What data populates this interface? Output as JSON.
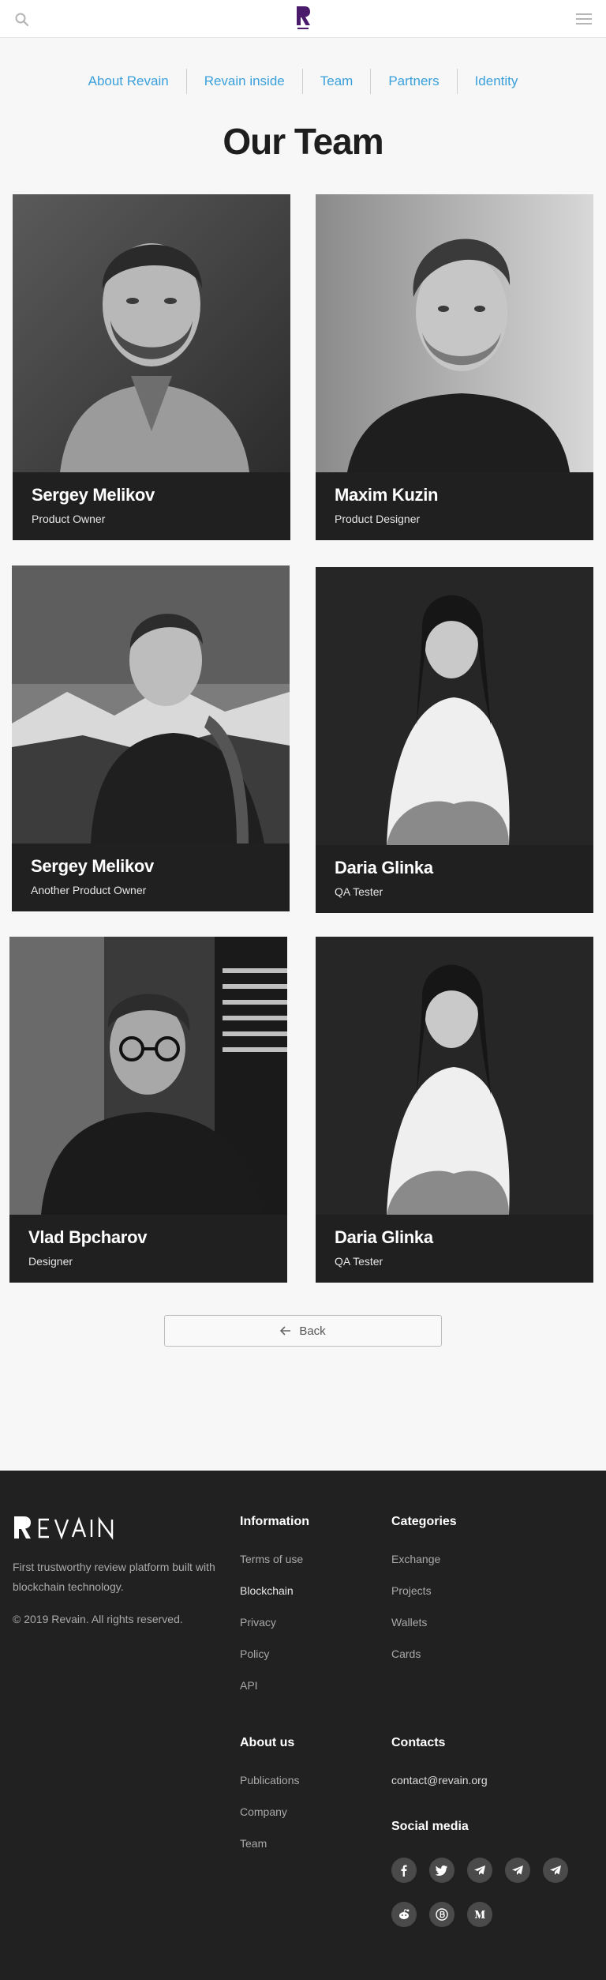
{
  "nav": [
    "About Revain",
    "Revain inside",
    "Team",
    "Partners",
    "Identity"
  ],
  "page": {
    "title": "Our Team"
  },
  "team": [
    {
      "name": "Sergey Melikov",
      "role": "Product Owner"
    },
    {
      "name": "Maxim Kuzin",
      "role": "Product Designer"
    },
    {
      "name": "Sergey Melikov",
      "role": "Another Product Owner"
    },
    {
      "name": "Daria Glinka",
      "role": "QA Tester"
    },
    {
      "name": "Vlad Bpcharov",
      "role": "Designer"
    },
    {
      "name": "Daria Glinka",
      "role": "QA Tester"
    }
  ],
  "back_label": "Back",
  "footer": {
    "tagline": "First trustworthy review platform built with blockchain technology.",
    "copyright": "© 2019 Revain. All rights reserved.",
    "information": {
      "title": "Information",
      "links": [
        "Terms of use",
        "Blockchain",
        "Privacy",
        "Policy",
        "API"
      ]
    },
    "categories": {
      "title": "Categories",
      "links": [
        "Exchange",
        "Projects",
        "Wallets",
        "Cards"
      ]
    },
    "about": {
      "title": "About us",
      "links": [
        "Publications",
        "Company",
        "Team"
      ]
    },
    "contacts": {
      "title": "Contacts",
      "email": "contact@revain.org"
    },
    "social_title": "Social media",
    "social_icons": [
      "facebook-icon",
      "twitter-icon",
      "telegram-icon",
      "telegram-icon",
      "telegram-icon",
      "reddit-icon",
      "bitcoin-icon",
      "medium-icon"
    ]
  },
  "colors": {
    "accent": "#3aa0dc",
    "brand": "#4b1b6b",
    "footer_bg": "#212121",
    "card_bg": "#202020"
  }
}
